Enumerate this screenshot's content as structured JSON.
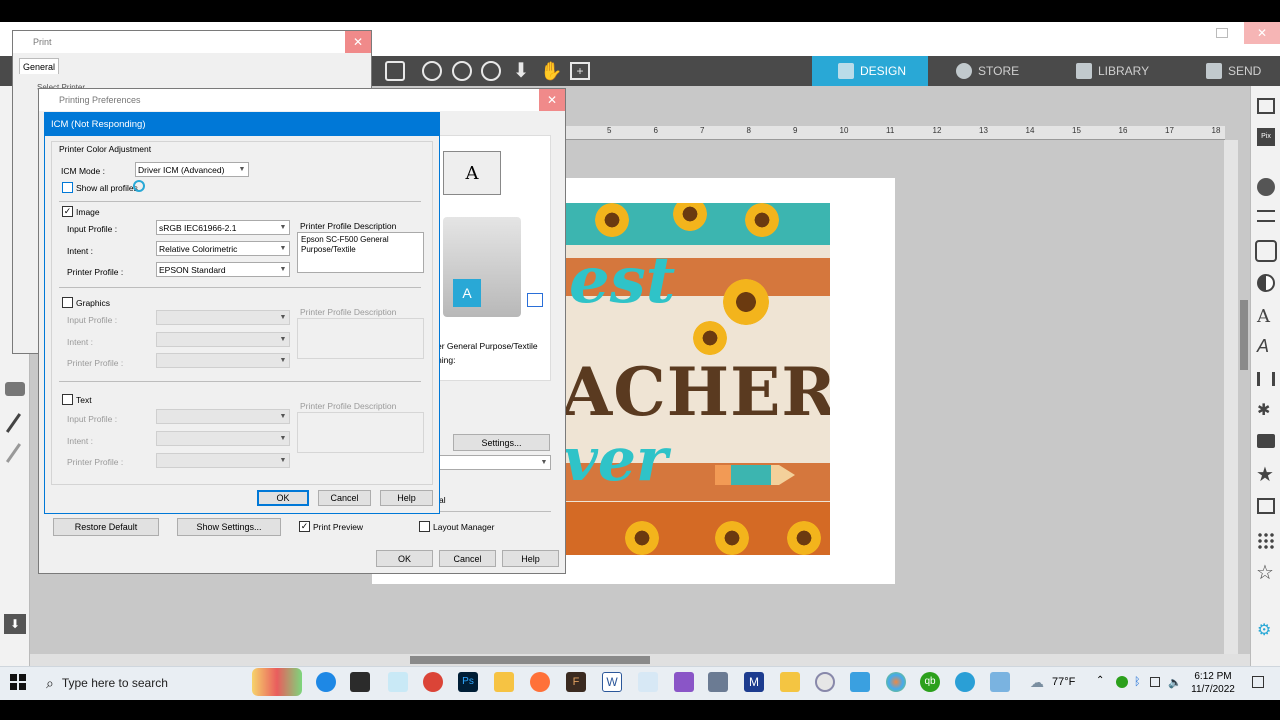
{
  "app": {
    "nav_tabs": [
      {
        "label": "DESIGN",
        "icon": "grid-icon"
      },
      {
        "label": "STORE",
        "icon": "store-icon"
      },
      {
        "label": "LIBRARY",
        "icon": "library-icon"
      },
      {
        "label": "SEND",
        "icon": "send-icon"
      }
    ],
    "ruler_marks": [
      "5",
      "6",
      "7",
      "8",
      "9",
      "10",
      "11",
      "12",
      "13",
      "14",
      "15",
      "16",
      "17",
      "18"
    ],
    "design_text": {
      "line1": "est",
      "line2": "ACHER",
      "line3": "ver"
    }
  },
  "print_dialog": {
    "title": "Print",
    "tab": "General",
    "fragment": "Select Printer"
  },
  "prefs_dialog": {
    "title": "Printing Preferences",
    "paper_desc": "er General Purpose/Textile",
    "paper_desc2": "ning:",
    "settings_label": "Settings...",
    "restore_default": "Restore Default",
    "show_settings": "Show Settings...",
    "print_preview": "Print Preview",
    "layout_manager": "Layout Manager",
    "ok": "OK",
    "cancel": "Cancel",
    "help": "Help",
    "partial_label": "al"
  },
  "icm_dialog": {
    "title": "ICM (Not Responding)",
    "group_label": "Printer Color Adjustment",
    "icm_mode_label": "ICM Mode :",
    "icm_mode_value": "Driver ICM (Advanced)",
    "show_all_profiles": "Show all profiles",
    "sections": [
      {
        "name": "Image",
        "checked": true,
        "input_profile_label": "Input Profile :",
        "input_profile_value": "sRGB IEC61966-2.1",
        "intent_label": "Intent :",
        "intent_value": "Relative Colorimetric",
        "printer_profile_label": "Printer Profile :",
        "printer_profile_value": "EPSON Standard",
        "desc_label": "Printer Profile Description",
        "desc_value": "Epson SC-F500 General Purpose/Textile"
      },
      {
        "name": "Graphics",
        "checked": false,
        "input_profile_label": "Input Profile :",
        "intent_label": "Intent :",
        "printer_profile_label": "Printer Profile :",
        "desc_label": "Printer Profile Description"
      },
      {
        "name": "Text",
        "checked": false,
        "input_profile_label": "Input Profile :",
        "intent_label": "Intent :",
        "printer_profile_label": "Printer Profile :",
        "desc_label": "Printer Profile Description"
      }
    ],
    "ok": "OK",
    "cancel": "Cancel",
    "help": "Help"
  },
  "taskbar": {
    "search_placeholder": "Type here to search",
    "temperature": "77°F",
    "time": "6:12 PM",
    "date": "11/7/2022"
  },
  "colors": {
    "accent": "#29a8d6",
    "titlebar_active": "#0078d7",
    "toolbar": "#4a4a4a"
  }
}
